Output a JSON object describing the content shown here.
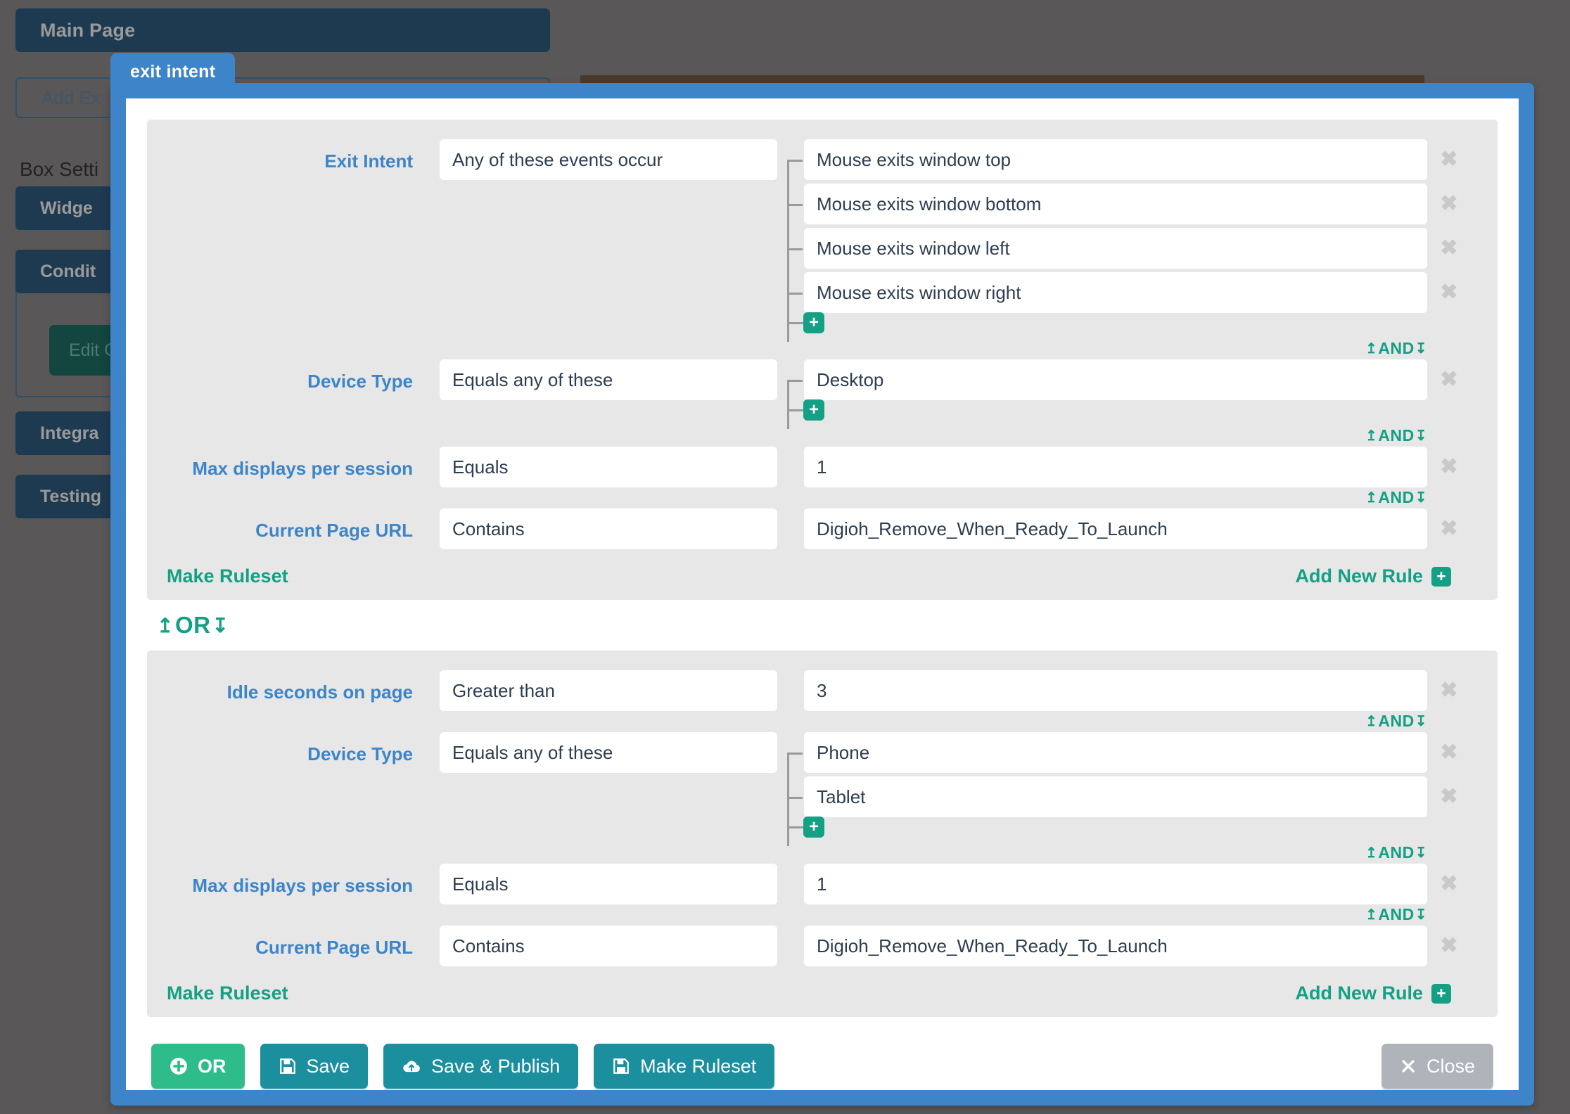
{
  "background": {
    "main_page_label": "Main Page",
    "add_exit_label": "Add Ex",
    "box_settings_label": "Box Setti",
    "nav_items": [
      {
        "label": "Widge"
      },
      {
        "label": "Condit"
      },
      {
        "label": "Integra"
      },
      {
        "label": "Testing"
      }
    ],
    "edit_conditions_label": "Edit C"
  },
  "modal": {
    "tab_title": "exit intent",
    "accent_color": "#3d85c8",
    "green_color": "#13a085",
    "label_color": "#3d85c8"
  },
  "rulesets": [
    {
      "make_ruleset_label": "Make Ruleset",
      "add_new_rule_label": "Add New Rule",
      "rules": [
        {
          "label": "Exit Intent",
          "operator": "Any of these events occur",
          "values": [
            "Mouse exits window top",
            "Mouse exits window bottom",
            "Mouse exits window left",
            "Mouse exits window right"
          ],
          "multi": true,
          "connector": "AND"
        },
        {
          "label": "Device Type",
          "operator": "Equals any of these",
          "values": [
            "Desktop"
          ],
          "multi": true,
          "connector": "AND"
        },
        {
          "label": "Max displays per session",
          "operator": "Equals",
          "values": [
            "1"
          ],
          "multi": false,
          "connector": "AND"
        },
        {
          "label": "Current Page URL",
          "operator": "Contains",
          "values": [
            "Digioh_Remove_When_Ready_To_Launch"
          ],
          "multi": false,
          "connector": ""
        }
      ]
    },
    {
      "make_ruleset_label": "Make Ruleset",
      "add_new_rule_label": "Add New Rule",
      "rules": [
        {
          "label": "Idle seconds on page",
          "operator": "Greater than",
          "values": [
            "3"
          ],
          "multi": false,
          "connector": "AND"
        },
        {
          "label": "Device Type",
          "operator": "Equals any of these",
          "values": [
            "Phone",
            "Tablet"
          ],
          "multi": true,
          "connector": "AND"
        },
        {
          "label": "Max displays per session",
          "operator": "Equals",
          "values": [
            "1"
          ],
          "multi": false,
          "connector": "AND"
        },
        {
          "label": "Current Page URL",
          "operator": "Contains",
          "values": [
            "Digioh_Remove_When_Ready_To_Launch"
          ],
          "multi": false,
          "connector": ""
        }
      ]
    }
  ],
  "ruleset_separator": "OR",
  "footer": {
    "or_label": "OR",
    "save_label": "Save",
    "save_publish_label": "Save & Publish",
    "make_ruleset_label": "Make Ruleset",
    "close_label": "Close"
  },
  "icons": {
    "plus_circle": "plus-circle-icon",
    "floppy": "floppy-disk-icon",
    "cloud_upload": "cloud-upload-icon",
    "close_x": "close-x-icon",
    "delete_x": "delete-x-icon",
    "add_value_plus": "plus-square-icon",
    "arrow_up": "↑",
    "arrow_down": "↓"
  }
}
